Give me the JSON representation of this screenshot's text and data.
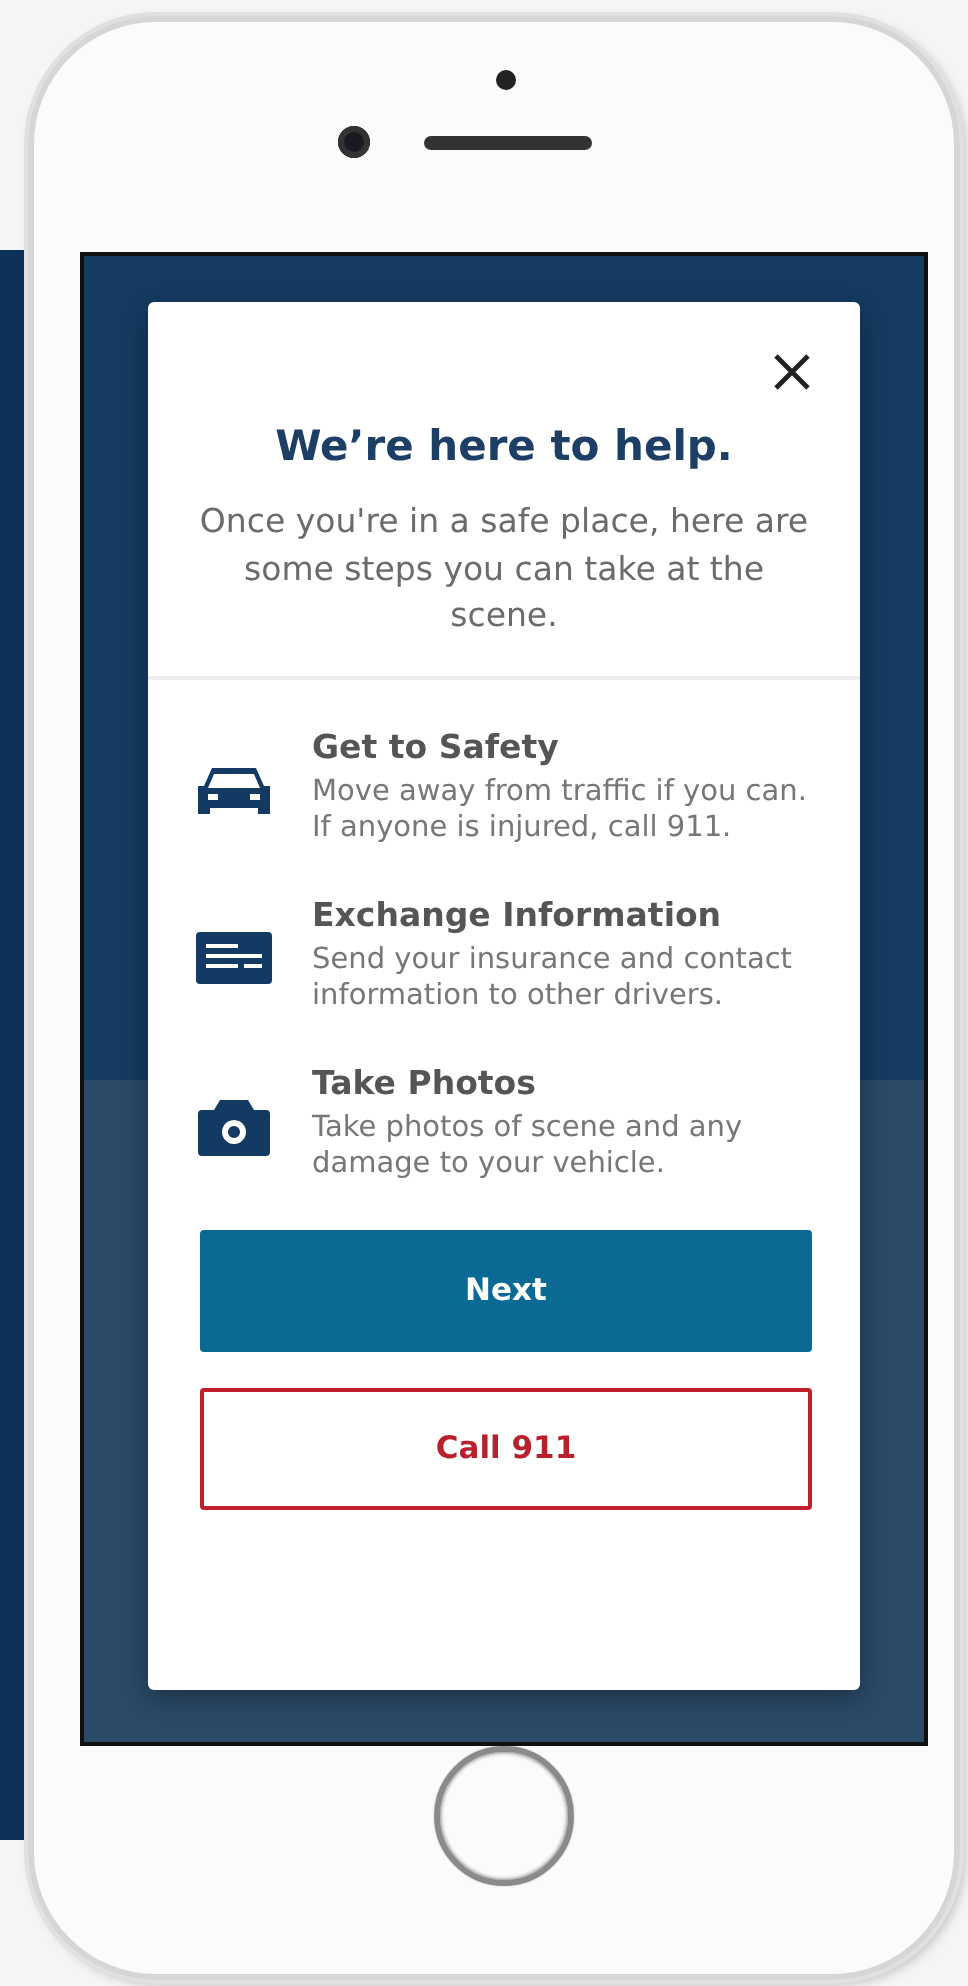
{
  "modal": {
    "title": "We’re here to help.",
    "subtitle": "Once you're in a safe place, here are some steps you can take at the scene.",
    "steps": [
      {
        "kind": "car",
        "title": "Get to Safety",
        "description": "Move away from traffic if you can. If anyone is injured, call 911."
      },
      {
        "kind": "card",
        "title": "Exchange Information",
        "description": "Send your insurance and contact information to other drivers."
      },
      {
        "kind": "camera",
        "title": "Take Photos",
        "description": "Take photos of scene and any damage to your vehicle."
      }
    ],
    "buttons": [
      {
        "kind": "primary",
        "label": "Next"
      },
      {
        "kind": "danger",
        "label": "Call 911"
      }
    ]
  }
}
